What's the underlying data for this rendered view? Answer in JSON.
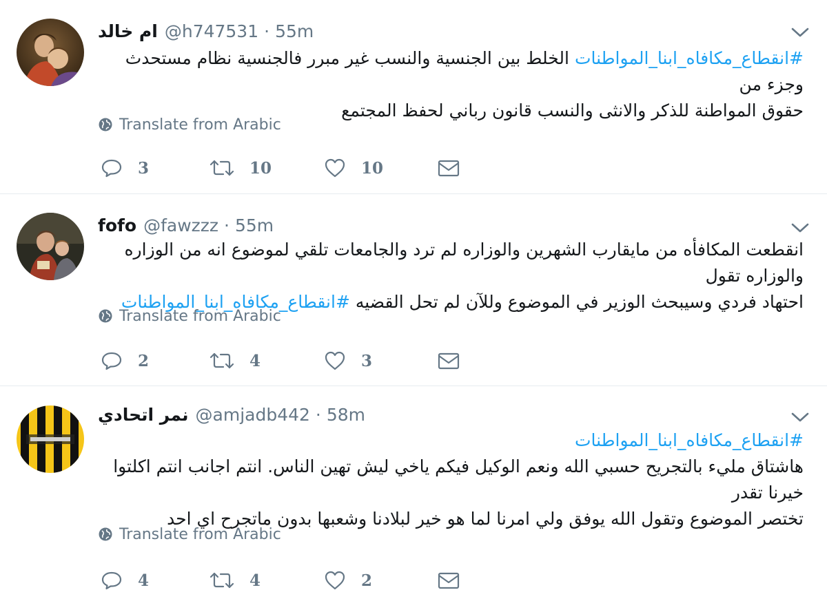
{
  "tweets": [
    {
      "display_name": "ام خالد",
      "handle": "@h747531",
      "separator": "·",
      "time": "55m",
      "text_lines": [
        {
          "hashtag": "#انقطاع_مكافاه_ابنا_المواطنات",
          "text": " الخلط بين الجنسية والنسب غير مبرر فالجنسية نظام مستحدث وجزء من"
        },
        {
          "hashtag": "",
          "text": "حقوق المواطنة للذكر والانثى والنسب قانون رباني لحفظ المجتمع"
        }
      ],
      "translate_label": "Translate from Arabic",
      "replies": "3",
      "retweets": "10",
      "likes": "10"
    },
    {
      "display_name": "fofo",
      "handle": "@fawzzz",
      "separator": "·",
      "time": "55m",
      "text_lines": [
        {
          "hashtag": "",
          "text": "انقطعت المكافأه من مايقارب الشهرين والوزاره لم ترد والجامعات تلقي لموضوع انه من الوزاره والوزاره تقول"
        },
        {
          "hashtag": "#انقطاع_مكافاه_ابنا_المواطنات",
          "text": "احتهاد فردي وسيبحث الوزير في الموضوع وللآن لم تحل القضيه "
        }
      ],
      "translate_label": "Translate from Arabic",
      "replies": "2",
      "retweets": "4",
      "likes": "3"
    },
    {
      "display_name": "نمر اتحادي",
      "handle": "@amjadb442",
      "separator": "·",
      "time": "58m",
      "text_lines": [
        {
          "hashtag": "#انقطاع_مكافاه_ابنا_المواطنات",
          "text": ""
        },
        {
          "hashtag": "",
          "text": "هاشتاق مليء بالتجريح حسبي الله ونعم الوكيل فيكم ياخي ليش تهين الناس. انتم اجانب انتم اكلتوا خيرنا تقدر"
        },
        {
          "hashtag": "",
          "text": "تختصر الموضوع وتقول الله يوفق ولي امرنا لما هو خير لبلادنا وشعبها بدون ماتجرح اي احد"
        }
      ],
      "translate_label": "Translate from Arabic",
      "replies": "4",
      "retweets": "4",
      "likes": "2"
    }
  ],
  "icons": {
    "reply": "reply-icon",
    "retweet": "retweet-icon",
    "like": "heart-icon",
    "dm": "envelope-icon",
    "translate": "globe-icon",
    "caret": "chevron-down-icon"
  },
  "colors": {
    "hashtag": "#1da1f2",
    "secondary_text": "#657786",
    "primary_text": "#14171a",
    "divider": "#e6ecf0"
  }
}
